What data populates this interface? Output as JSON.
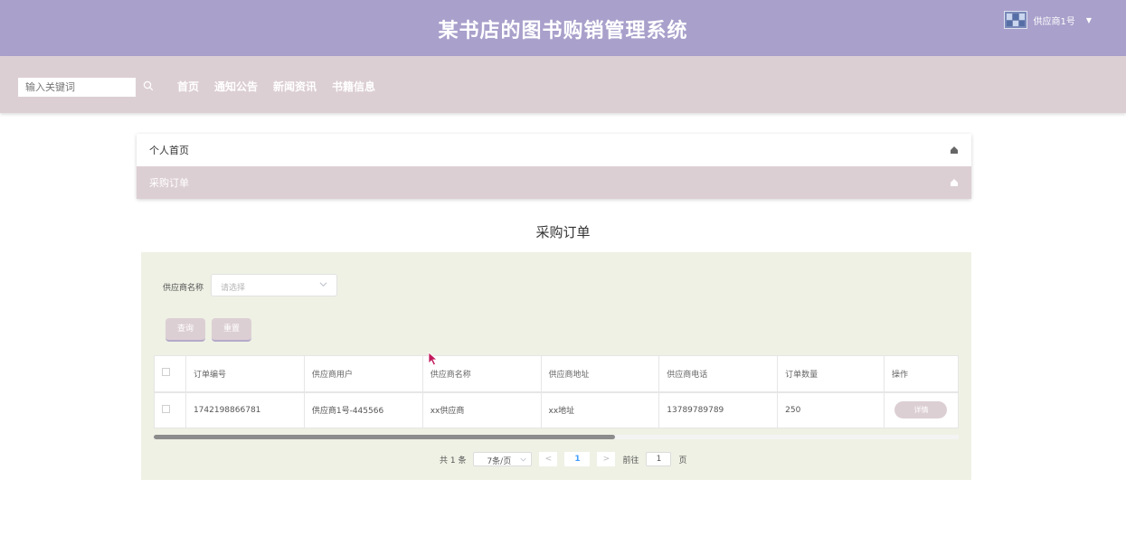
{
  "header": {
    "title": "某书店的图书购销管理系统",
    "user": "供应商1号",
    "colors": {
      "header_bg": "#a9a0cb",
      "nav_bg": "#dccfd4",
      "content_bg": "#eef1e4"
    }
  },
  "nav": {
    "search_placeholder": "输入关键词",
    "links": [
      "首页",
      "通知公告",
      "新闻资讯",
      "书籍信息"
    ]
  },
  "panel": {
    "items": [
      "个人首页",
      "采购订单"
    ]
  },
  "page_title": "采购订单",
  "filter": {
    "label": "供应商名称",
    "placeholder": "请选择",
    "query_label": "查询",
    "reset_label": "重置"
  },
  "table": {
    "columns": [
      "订单编号",
      "供应商用户",
      "供应商名称",
      "供应商地址",
      "供应商电话",
      "订单数量",
      "操作"
    ],
    "rows": [
      [
        "1742198866781",
        "供应商1号-445566",
        "xx供应商",
        "xx地址",
        "13789789789",
        "250",
        "详情"
      ]
    ]
  },
  "pagination": {
    "total": "共 1 条",
    "page_size": "7条/页",
    "current_page": "1",
    "goto_label": "前往",
    "goto_value": "1",
    "page_suffix": "页"
  }
}
